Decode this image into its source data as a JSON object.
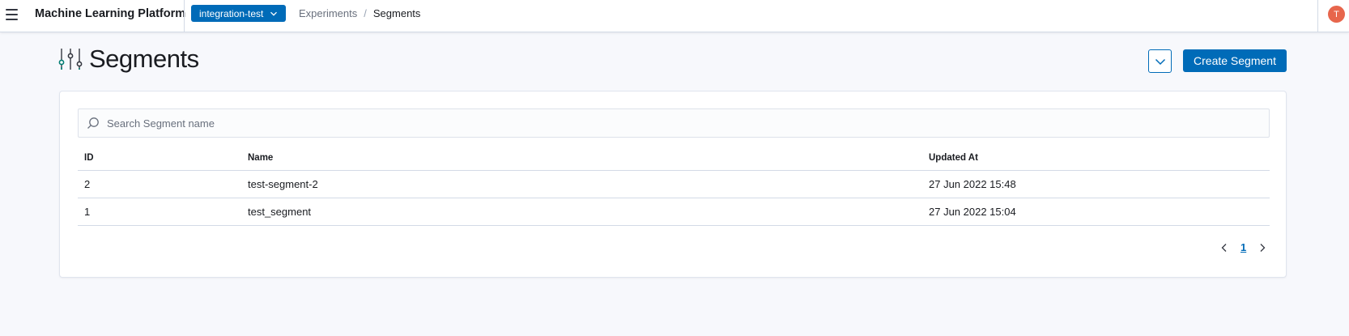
{
  "header": {
    "app_title": "Machine Learning Platform",
    "environment": "integration-test",
    "breadcrumbs": [
      {
        "label": "Experiments"
      },
      {
        "label": "Segments"
      }
    ],
    "breadcrumb_separator": "/",
    "avatar_initial": "T"
  },
  "page": {
    "title": "Segments",
    "create_button": "Create Segment"
  },
  "search": {
    "placeholder": "Search Segment name",
    "value": ""
  },
  "table": {
    "columns": {
      "id": "ID",
      "name": "Name",
      "updated_at": "Updated At"
    },
    "rows": [
      {
        "id": "2",
        "name": "test-segment-2",
        "updated_at": "27 Jun 2022 15:48"
      },
      {
        "id": "1",
        "name": "test_segment",
        "updated_at": "27 Jun 2022 15:04"
      }
    ]
  },
  "pagination": {
    "current_page": "1"
  },
  "colors": {
    "primary": "#006bb8",
    "avatar": "#e7664c",
    "icon_accent": "#017d73",
    "background": "#f7f8fc"
  },
  "icons": {
    "menu": "hamburger-menu-icon",
    "env_dropdown": "chevron-down-icon",
    "page": "sliders-icon",
    "collapse": "chevron-down-icon",
    "search": "search-icon",
    "prev": "chevron-left-icon",
    "next": "chevron-right-icon"
  }
}
